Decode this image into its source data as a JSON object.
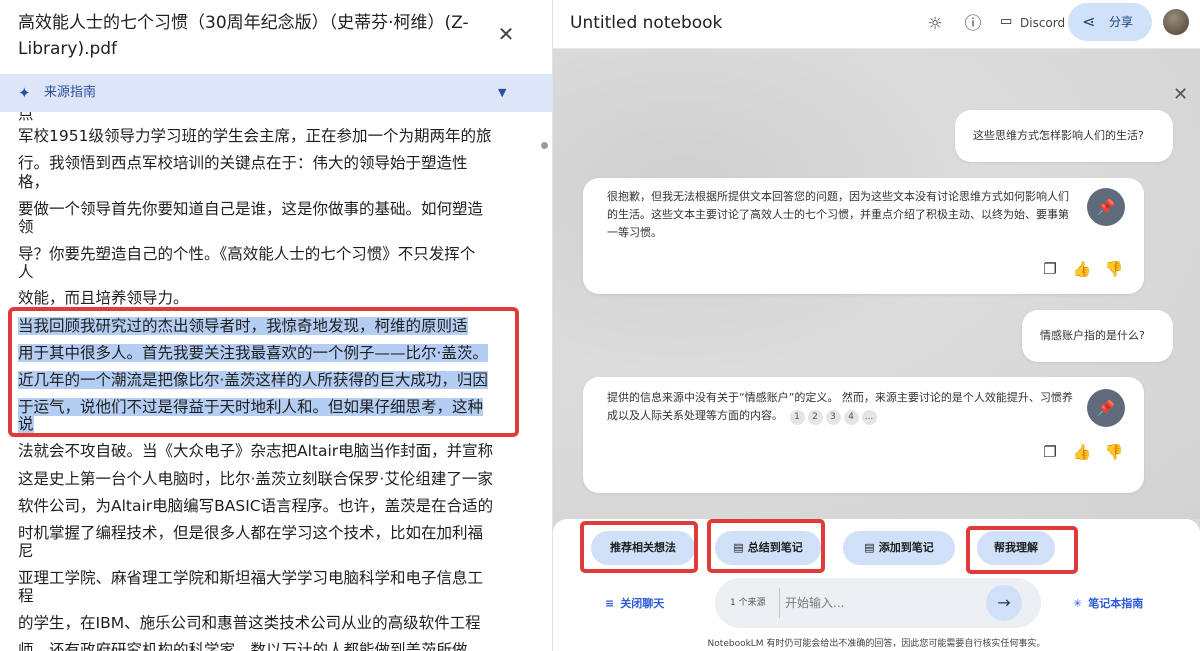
{
  "source_panel": {
    "title": "高效能人士的七个习惯（30周年纪念版）（史蒂芬·柯维）(Z-Library).pdf",
    "close_icon": "close-icon",
    "guide_label": "来源指南",
    "lines": [
      "点",
      "军校1951级领导力学习班的学生会主席，正在参加一个为期两年的旅",
      "行。我领悟到西点军校培训的关键点在于：伟大的领导始于塑造性",
      "格，",
      "要做一个领导首先你要知道自己是谁，这是你做事的基础。如何塑造",
      "领",
      "导？你要先塑造自己的个性。《高效能人士的七个习惯》不只发挥个",
      "人",
      "效能，而且培养领导力。",
      "当我回顾我研究过的杰出领导者时，我惊奇地发现，柯维的原则适",
      "用于其中很多人。首先我要关注我最喜欢的一个例子——比尔·盖茨。",
      "近几年的一个潮流是把像比尔·盖茨这样的人所获得的巨大成功，归因",
      "于运气，说他们不过是得益于天时地利人和。但如果仔细思考，这种",
      "说",
      "法就会不攻自破。当《大众电子》杂志把Altair电脑当作封面，并宣称",
      "这是史上第一台个人电脑时，比尔·盖茨立刻联合保罗·艾伦组建了一家",
      "软件公司，为Altair电脑编写BASIC语言程序。也许，盖茨是在合适的",
      "时机掌握了编程技术，但是很多人都在学习这个技术，比如在加利福",
      "尼",
      "亚理工学院、麻省理工学院和斯坦福大学学习电脑科学和电子信息工",
      "程",
      "的学生，在IBM、施乐公司和惠普这类技术公司从业的高级软件工程",
      "师，还有政府研究机构的科学家，数以万计的人都能做到盖茨所做"
    ]
  },
  "notebook": {
    "title": "Untitled notebook",
    "discord_label": "Discord",
    "share_label": "分享",
    "messages": [
      {
        "role": "user",
        "text": "这些思维方式怎样影响人们的生活?"
      },
      {
        "role": "bot",
        "text": "很抱歉，但我无法根据所提供文本回答您的问题，因为这些文本没有讨论思维方式如何影响人们的生活。这些文本主要讨论了高效人士的七个习惯，并重点介绍了积极主动、以终为始、要事第一等习惯。"
      },
      {
        "role": "user",
        "text": "情感账户指的是什么?"
      },
      {
        "role": "bot",
        "text": "提供的信息来源中没有关于“情感账户”的定义。 然而，来源主要讨论的是个人效能提升、习惯养成以及人际关系处理等方面的内容。",
        "citations": [
          "1",
          "2",
          "3",
          "4",
          "..."
        ]
      }
    ],
    "suggestions": [
      "推荐相关想法",
      "总结到笔记",
      "添加到笔记",
      "帮我理解"
    ],
    "close_chat_label": "关闭聊天",
    "source_count": "1 个来源",
    "input_placeholder": "开始输入...",
    "notebook_guide_label": "笔记本指南",
    "disclaimer": "NotebookLM 有时仍可能会给出不准确的回答，因此您可能需要自行核实任何事实。"
  },
  "colors": {
    "highlight": "#b4cdf3",
    "annotation_red": "#e03a3a",
    "accent_blue": "#cfe0f8",
    "guide_bar": "#dde6f9"
  }
}
